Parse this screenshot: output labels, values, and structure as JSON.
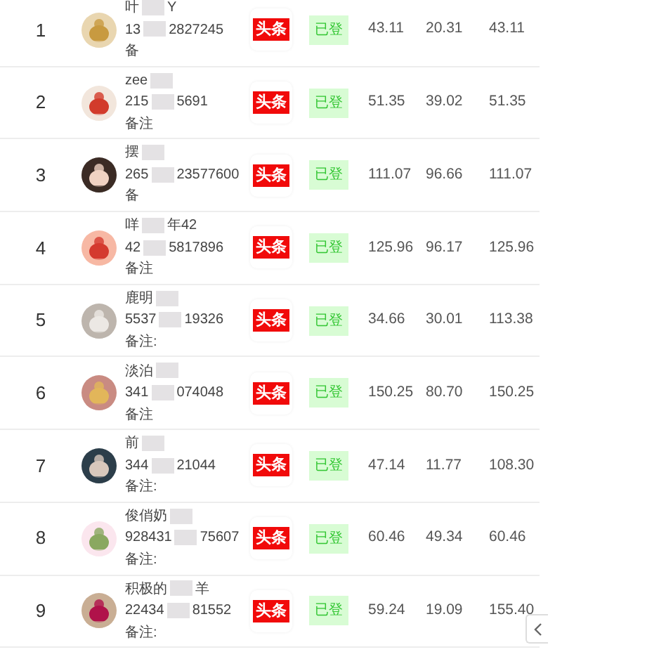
{
  "rows": [
    {
      "index": "1",
      "name": [
        "叶",
        "Y"
      ],
      "account": [
        "13",
        "2827245"
      ],
      "note": "备",
      "platform": "头条",
      "status": "已登",
      "values": [
        "43.11",
        "20.31",
        "43.11"
      ]
    },
    {
      "index": "2",
      "name": [
        "zee"
      ],
      "account": [
        "215",
        "5691"
      ],
      "note": "备注",
      "platform": "头条",
      "status": "已登",
      "values": [
        "51.35",
        "39.02",
        "51.35"
      ]
    },
    {
      "index": "3",
      "name": [
        "摆"
      ],
      "account": [
        "265",
        "23577600"
      ],
      "note": "备",
      "platform": "头条",
      "status": "已登",
      "values": [
        "111.07",
        "96.66",
        "111.07"
      ]
    },
    {
      "index": "4",
      "name": [
        "咩",
        "年42"
      ],
      "account": [
        "42",
        "5817896"
      ],
      "note": "备注",
      "platform": "头条",
      "status": "已登",
      "values": [
        "125.96",
        "96.17",
        "125.96"
      ]
    },
    {
      "index": "5",
      "name": [
        "鹿明"
      ],
      "account": [
        "5537",
        "19326"
      ],
      "note": "备注:",
      "platform": "头条",
      "status": "已登",
      "values": [
        "34.66",
        "30.01",
        "113.38"
      ]
    },
    {
      "index": "6",
      "name": [
        "淡泊"
      ],
      "account": [
        "341",
        "074048"
      ],
      "note": "备注",
      "platform": "头条",
      "status": "已登",
      "values": [
        "150.25",
        "80.70",
        "150.25"
      ]
    },
    {
      "index": "7",
      "name": [
        "前"
      ],
      "account": [
        "344",
        "21044"
      ],
      "note": "备注:",
      "platform": "头条",
      "status": "已登",
      "values": [
        "47.14",
        "11.77",
        "108.30"
      ]
    },
    {
      "index": "8",
      "name": [
        "俊俏奶"
      ],
      "account": [
        "928431",
        "75607"
      ],
      "note": "备注:",
      "platform": "头条",
      "status": "已登",
      "values": [
        "60.46",
        "49.34",
        "60.46"
      ]
    },
    {
      "index": "9",
      "name": [
        "积极的",
        "羊"
      ],
      "account": [
        "22434",
        "81552"
      ],
      "note": "备注:",
      "platform": "头条",
      "status": "已登",
      "values": [
        "59.24",
        "19.09",
        "155.40"
      ]
    }
  ]
}
